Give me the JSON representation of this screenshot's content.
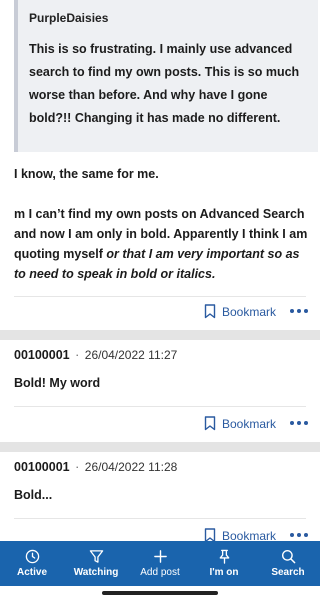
{
  "post1": {
    "quote_author": "PurpleDaisies",
    "quote_text": "This is so frustrating. I mainly use advanced search to find my own posts. This is so much worse than before. And why have I gone bold?!! Changing it has made no different.",
    "para1": "I know, the same for me.",
    "para2_plain": "m I can’t find my own posts on Advanced Search and now I am only in bold. Apparently I think I am quoting myself ",
    "para2_italic": "or that I am very important so as to need to speak in bold or italics.",
    "bookmark_label": "Bookmark"
  },
  "post2": {
    "username": "00100001",
    "separator": "·",
    "date": "26/04/2022 11:27",
    "text": "Bold! My word",
    "bookmark_label": "Bookmark"
  },
  "post3": {
    "username": "00100001",
    "separator": "·",
    "date": "26/04/2022 11:28",
    "text": "Bold...",
    "bookmark_label": "Bookmark"
  },
  "nav": {
    "active": "Active",
    "watching": "Watching",
    "add_post": "Add post",
    "im_on": "I'm on",
    "search": "Search"
  },
  "icons": {
    "active": "clock-icon",
    "watching": "filter-funnel-icon",
    "add_post": "plus-icon",
    "im_on": "pin-icon",
    "search": "search-icon",
    "bookmark": "bookmark-icon",
    "more": "more-dots-icon"
  },
  "colors": {
    "accent": "#1a64ad",
    "link": "#2a5aa0"
  }
}
